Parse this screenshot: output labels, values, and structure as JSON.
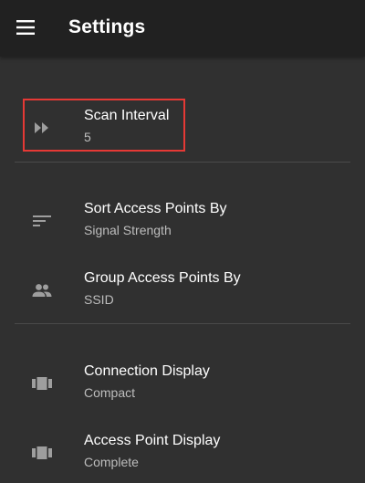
{
  "app_bar": {
    "menu_icon": "menu-icon",
    "title": "Settings"
  },
  "settings": {
    "items": [
      {
        "title": "Scan Interval",
        "value": "5",
        "icon": "fast-forward-icon",
        "highlighted": true
      },
      {
        "title": "Sort Access Points By",
        "value": "Signal Strength",
        "icon": "sort-icon"
      },
      {
        "title": "Group Access Points By",
        "value": "SSID",
        "icon": "group-icon"
      },
      {
        "title": "Connection Display",
        "value": "Compact",
        "icon": "view-array-icon"
      },
      {
        "title": "Access Point Display",
        "value": "Complete",
        "icon": "view-array-icon"
      }
    ]
  },
  "colors": {
    "app_bar_background": "#212121",
    "background": "#303030",
    "highlight_border": "#e53935",
    "icon": "#9e9e9e"
  }
}
